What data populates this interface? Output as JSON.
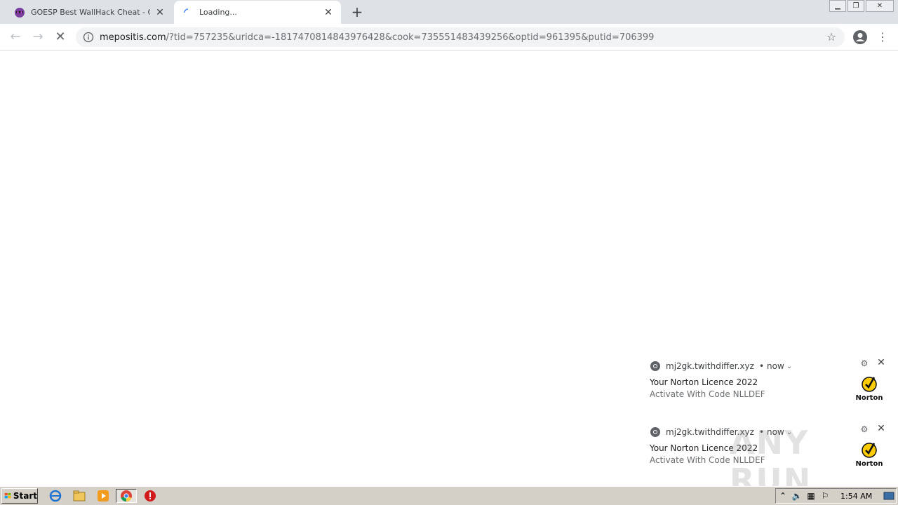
{
  "browser": {
    "tabs": [
      {
        "title": "GOESP Best WallHack Cheat - CSGO",
        "active": false
      },
      {
        "title": "Loading...",
        "active": true
      }
    ],
    "new_tab_symbol": "+",
    "url_host": "mepositis.com",
    "url_rest": "/?tid=757235&uridca=-1817470814843976428&cook=735551483439256&optid=961395&putid=706399",
    "icons": [
      "back-icon",
      "forward-icon",
      "stop-icon",
      "info-icon",
      "bookmark-star-icon",
      "profile-icon",
      "menu-icon"
    ]
  },
  "notifications": [
    {
      "origin": "mj2gk.twithdiffer.xyz",
      "time": "now",
      "title": "Your Norton Licence 2022",
      "body": "Activate With Code NLLDEF",
      "logo_label": "Norton"
    },
    {
      "origin": "mj2gk.twithdiffer.xyz",
      "time": "now",
      "title": "Your Norton Licence 2022",
      "body": "Activate With Code NLLDEF",
      "logo_label": "Norton"
    }
  ],
  "watermark": "ANY RUN",
  "taskbar": {
    "start_label": "Start",
    "clock": "1:54 AM",
    "icons": [
      "ie-icon",
      "explorer-icon",
      "media-player-icon",
      "chrome-icon",
      "stop-sign-icon"
    ]
  },
  "colors": {
    "tabstrip": "#dee1e6",
    "taskbar": "#d4d0c8",
    "norton_yellow": "#ffcc00"
  }
}
